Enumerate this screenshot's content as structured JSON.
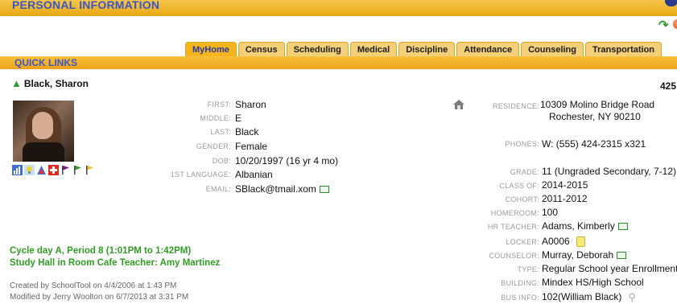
{
  "header": {
    "title": "PERSONAL INFORMATION"
  },
  "tabs": [
    {
      "label": "MyHome",
      "active": true
    },
    {
      "label": "Census"
    },
    {
      "label": "Scheduling"
    },
    {
      "label": "Medical"
    },
    {
      "label": "Discipline"
    },
    {
      "label": "Attendance"
    },
    {
      "label": "Counseling"
    },
    {
      "label": "Transportation"
    }
  ],
  "quicklinks": {
    "label": "QUICK LINKS"
  },
  "student": {
    "name": "Black, Sharon",
    "id_partial": "425",
    "first_label": "FIRST:",
    "first": "Sharon",
    "middle_label": "MIDDLE:",
    "middle": "E",
    "last_label": "LAST:",
    "last": "Black",
    "gender_label": "GENDER:",
    "gender": "Female",
    "dob_label": "DOB:",
    "dob": "10/20/1997 (16 yr 4 mo)",
    "language_label": "1ST LANGUAGE:",
    "language": "Albanian",
    "email_label": "EMAIL:",
    "email": "SBlack@tmail.xom",
    "residence_label": "RESIDENCE:",
    "residence_line1": "10309 Molino Bridge Road",
    "residence_line2": "Rochester, NY 90210",
    "phones_label": "PHONES:",
    "phones": "W:  (555) 424-2315 x321",
    "grade_label": "GRADE:",
    "grade": "11 (Ungraded Secondary, 7-12)",
    "classof_label": "CLASS OF:",
    "classof": "2014-2015",
    "cohort_label": "COHORT:",
    "cohort": "2011-2012",
    "homeroom_label": "HOMEROOM:",
    "homeroom": "100",
    "hrteacher_label": "HR TEACHER:",
    "hrteacher": "Adams, Kimberly",
    "locker_label": "LOCKER:",
    "locker": "A0006",
    "counselor_label": "COUNSELOR:",
    "counselor": "Murray, Deborah",
    "type_label": "TYPE:",
    "type": "Regular School year Enrollment",
    "building_label": "BUILDING:",
    "building": "Mindex HS/High School",
    "businfo_label": "BUS INFO:",
    "businfo": "102(William Black)"
  },
  "schedule": {
    "line1": "Cycle day A, Period 8 (1:01PM to 1:42PM)",
    "line2": "Study Hall in Room Cafe Teacher: Amy Martinez"
  },
  "footer": {
    "created": "Created by SchoolTool on 4/4/2006 at 1:43 PM",
    "modified": "Modified by Jerry Woolton on 6/7/2013 at 3:31 PM"
  },
  "colors": {
    "header_orange": "#f0b022",
    "link_blue": "#3a55c6",
    "schedule_green": "#2f9e22"
  },
  "icons": [
    "refresh-arrow-icon",
    "close-ball-icon",
    "green-up-arrow-icon",
    "bar-chart-icon",
    "lightbulb-icon",
    "triangle-icon",
    "red-cross-icon",
    "flag-icon",
    "green-flag-icon",
    "yellow-flag-icon",
    "house-icon",
    "mail-icon",
    "lock-icon",
    "magnifier-icon"
  ]
}
